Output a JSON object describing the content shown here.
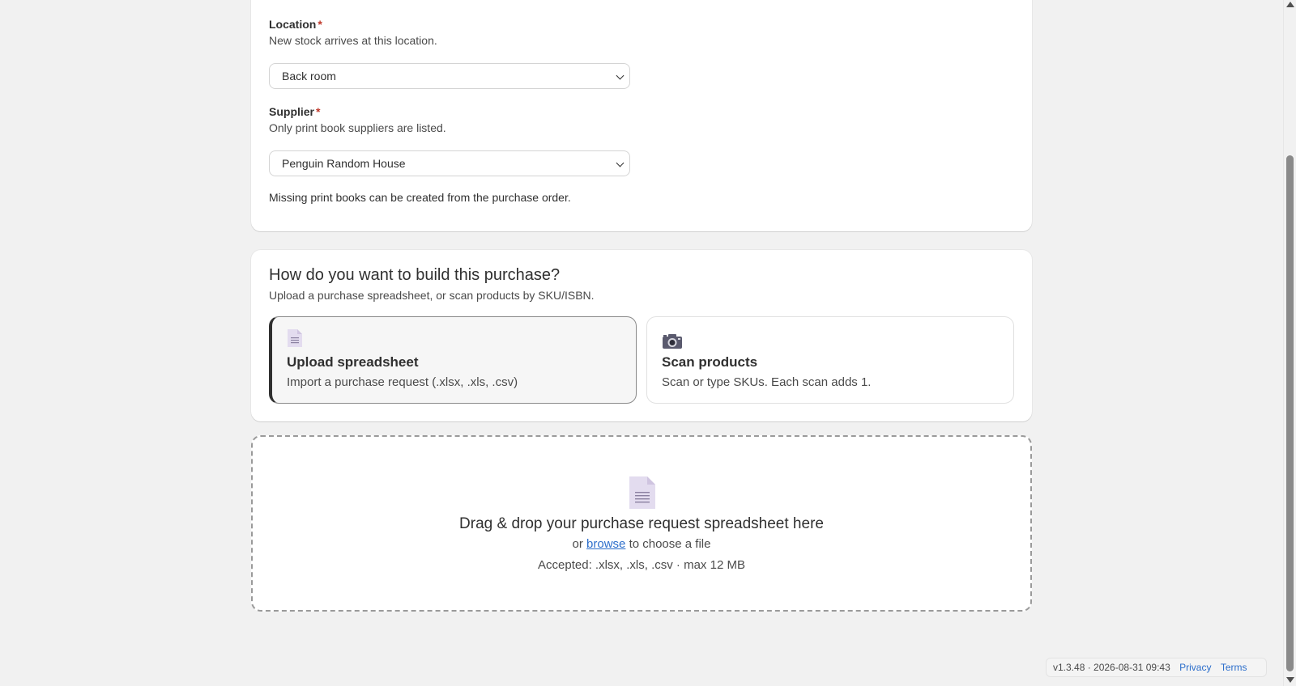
{
  "form": {
    "location": {
      "label": "Location",
      "required_mark": "*",
      "help": "New stock arrives at this location.",
      "value": "Back room"
    },
    "supplier": {
      "label": "Supplier",
      "required_mark": "*",
      "help": "Only print book suppliers are listed.",
      "value": "Penguin Random House"
    },
    "note": "Missing print books can be created from the purchase order."
  },
  "build": {
    "title": "How do you want to build this purchase?",
    "subtitle": "Upload a purchase spreadsheet, or scan products by SKU/ISBN.",
    "options": [
      {
        "title": "Upload spreadsheet",
        "description": "Import a purchase request (.xlsx, .xls, .csv)",
        "icon": "document-icon",
        "selected": true
      },
      {
        "title": "Scan products",
        "description": "Scan or type SKUs. Each scan adds 1.",
        "icon": "camera-icon",
        "selected": false
      }
    ]
  },
  "dropzone": {
    "icon": "document-icon",
    "title": "Drag & drop your purchase request spreadsheet here",
    "browse_prefix": "or",
    "browse_link": "browse",
    "browse_suffix": "to choose a file",
    "accepted": "Accepted: .xlsx, .xls, .csv · max 12 MB"
  },
  "footer": {
    "version": "v1.3.48 · 2026-08-31 09:43",
    "privacy": "Privacy",
    "terms": "Terms"
  },
  "colors": {
    "page_bg": "#f1f1f1",
    "card_bg": "#ffffff",
    "text": "#303030",
    "link": "#2c6ecb",
    "required": "#c0392b",
    "icon_doc": "#e3dcef"
  }
}
